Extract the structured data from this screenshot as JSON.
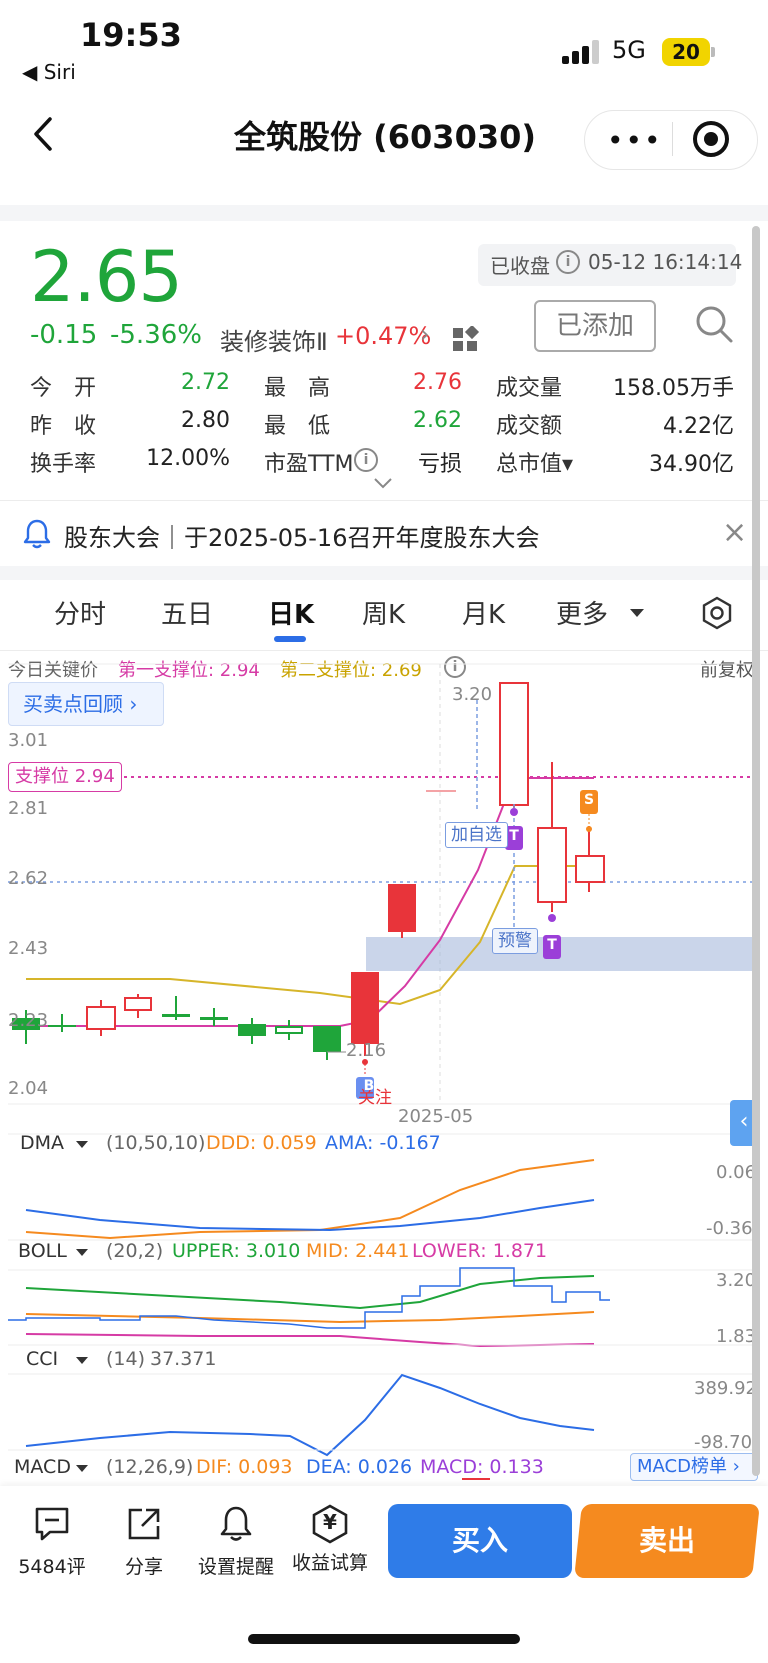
{
  "status_bar": {
    "time": "19:53",
    "back_app": "◀ Siri",
    "network": "5G",
    "battery": "20"
  },
  "header": {
    "title": "全筑股份 (603030)",
    "capsule_dots": "•••"
  },
  "quote": {
    "price": "2.65",
    "change": "-0.15",
    "change_pct": "-5.36%",
    "sector": "装修装饰Ⅱ",
    "sector_change": "+0.47%",
    "status": "已收盘",
    "timestamp": "05-12 16:14:14",
    "added_label": "已添加",
    "stats": [
      {
        "label": "今　开",
        "value": "2.72",
        "color": "#1fa53a"
      },
      {
        "label": "最　高",
        "value": "2.76",
        "color": "#e8343a"
      },
      {
        "label": "成交量",
        "value": "158.05万手",
        "color": "#222222"
      },
      {
        "label": "昨　收",
        "value": "2.80",
        "color": "#222222"
      },
      {
        "label": "最　低",
        "value": "2.62",
        "color": "#1fa53a"
      },
      {
        "label": "成交额",
        "value": "4.22亿",
        "color": "#222222"
      },
      {
        "label": "换手率",
        "value": "12.00%",
        "color": "#222222"
      },
      {
        "label": "市盈TTM",
        "value": "亏损",
        "color": "#222222"
      },
      {
        "label": "总市值▾",
        "value": "34.90亿",
        "color": "#222222"
      }
    ]
  },
  "notice": {
    "text": "股东大会｜于2025-05-16召开年度股东大会"
  },
  "tabs": [
    "分时",
    "五日",
    "日K",
    "周K",
    "月K",
    "更多"
  ],
  "active_tab": "日K",
  "key_price": {
    "label": "今日关键价",
    "support1": "第一支撑位: 2.94",
    "support2": "第二支撑位: 2.69",
    "adjust": "前复权"
  },
  "chart": {
    "buy_review": "买卖点回顾 ›",
    "support_tag": "支撑位 2.94",
    "y_labels": [
      "3.01",
      "2.81",
      "2.62",
      "2.43",
      "2.23",
      "2.04"
    ],
    "high_label": "3.20",
    "low_label": "2.16",
    "date_label": "2025-05",
    "add_watch": "加自选",
    "alert": "预警",
    "markers": {
      "b": "B",
      "t": "T",
      "s": "S",
      "guan": "关注"
    },
    "side_arrow": "‹",
    "colors": {
      "up": "#e8343a",
      "down": "#1fa53a",
      "ma5": "#d63ba5",
      "ma10": "#d6b52a",
      "support": "#d63ba5"
    }
  },
  "indicators": {
    "dma": {
      "name": "DMA",
      "params": "(10,50,10)",
      "ddd": "DDD: 0.059",
      "ama": "AMA: -0.167",
      "axis_top": "0.06",
      "axis_bottom": "-0.36"
    },
    "boll": {
      "name": "BOLL",
      "params": "(20,2)",
      "upper": "UPPER: 3.010",
      "mid": "MID: 2.441",
      "lower": "LOWER: 1.871",
      "axis_top": "3.20",
      "axis_bottom": "1.83"
    },
    "cci": {
      "name": "CCI",
      "params": "(14)",
      "value": "37.371",
      "axis_top": "389.92",
      "axis_bottom": "-98.70"
    },
    "macd": {
      "name": "MACD",
      "params": "(12,26,9)",
      "dif": "DIF: 0.093",
      "dea": "DEA: 0.026",
      "macd": "MACD: 0.133",
      "board": "MACD榜单 ›"
    }
  },
  "bottom_bar": {
    "comments": "5484评",
    "share": "分享",
    "alert": "设置提醒",
    "calc": "收益试算",
    "calc_glyph": "¥",
    "buy": "买入",
    "sell": "卖出"
  }
}
